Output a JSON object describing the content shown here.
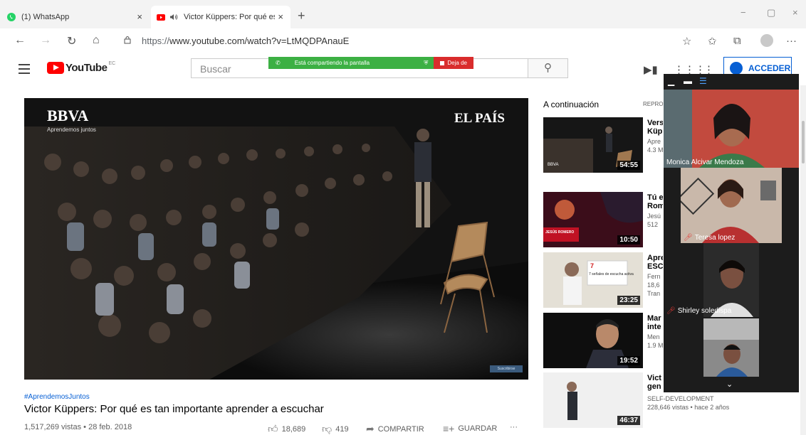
{
  "browser": {
    "tabs": [
      {
        "title": "(1) WhatsApp",
        "close": "×"
      },
      {
        "title": "Victor Küppers: Por qué es t",
        "close": "×",
        "active": true
      }
    ],
    "new_tab": "+",
    "window_controls": {
      "minimize": "−",
      "maximize": "▢",
      "close": "×"
    },
    "nav": {
      "back": "←",
      "forward": "→",
      "reload": "↻",
      "home": "⌂"
    },
    "url": {
      "scheme": "https://",
      "rest": "www.youtube.com/watch?v=LtMQDPAnauE"
    },
    "toolbar_icons": [
      "star-icon",
      "favorites-icon",
      "collections-icon",
      "profile-icon",
      "more-icon"
    ],
    "more": "···"
  },
  "youtube": {
    "logo_text": "YouTube",
    "country_code": "EC",
    "search_placeholder": "Buscar",
    "signin_label": "ACCEDER"
  },
  "screen_share": {
    "message": "Está compartiendo la pantalla",
    "stop_label": "Deja de"
  },
  "player": {
    "brand_left": "BBVA",
    "brand_left_sub": "Aprendemos juntos",
    "brand_right": "EL PAÍS",
    "subscribe_mini": "Suscribirse"
  },
  "video": {
    "hashtag": "#AprendemosJuntos",
    "title": "Victor Küppers: Por qué es tan importante aprender a escuchar",
    "views_date": "1,517,269 vistas • 28 feb. 2018",
    "likes": "18,689",
    "dislikes": "419",
    "share_label": "COMPARTIR",
    "save_label": "GUARDAR",
    "more": "···"
  },
  "up_next": {
    "heading": "A continuación",
    "autoplay_label": "REPRO",
    "items": [
      {
        "title_partial": "Vers",
        "title_line2": "Küp",
        "meta1": "Apre",
        "meta2": "4.3 M",
        "duration": "54:55",
        "thumb_caption": "BBVA"
      },
      {
        "title_partial": "Tú e",
        "title_line2": "Rom",
        "meta1": "Jesú",
        "meta2": "512",
        "duration": "10:50",
        "thumb_caption": "JESÚS ROMERO"
      },
      {
        "title_partial": "Apre",
        "title_line2": "ESC",
        "meta1": "Fern",
        "meta2": "18,6",
        "meta3": "Tran",
        "duration": "23:25",
        "thumb_caption": "7 señales de escucha activa"
      },
      {
        "title_partial": "Mar",
        "title_line2": "inte",
        "meta1": "Men",
        "meta2": "1.9 M",
        "duration": "19:52"
      },
      {
        "title_partial": "Vict",
        "title_line2": "gen",
        "meta1": "SELF-DEVELOPMENT",
        "meta2": "228,646 vistas • hace 2 años",
        "duration": "46:37"
      }
    ]
  },
  "call": {
    "participants": [
      {
        "name": "Monica Alcivar Mendoza",
        "muted": false
      },
      {
        "name": "Teresa lopez",
        "muted": true
      },
      {
        "name": "Shirley soledispa",
        "muted": true
      },
      {
        "name": "",
        "muted": false
      }
    ],
    "collapse_icon": "⌄"
  }
}
